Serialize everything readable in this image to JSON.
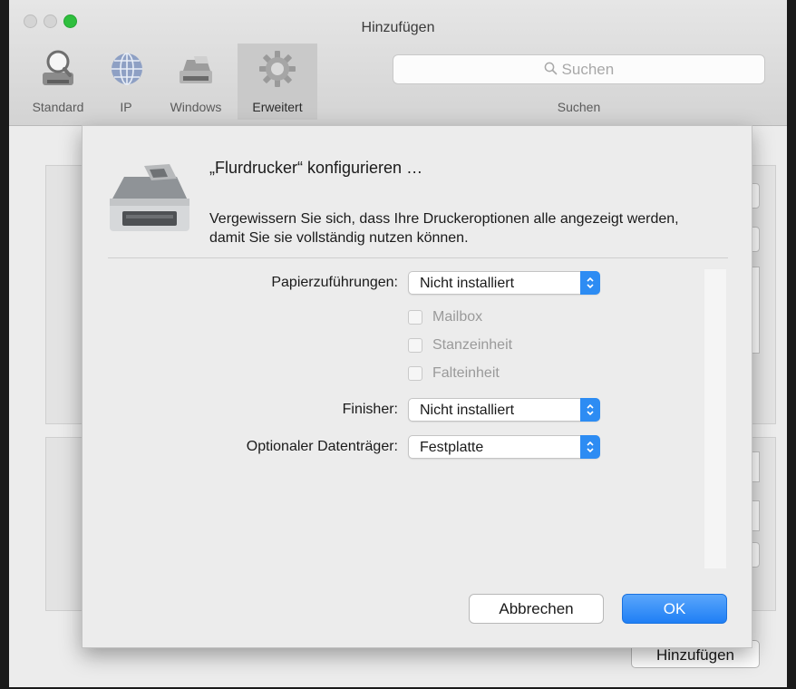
{
  "window": {
    "title": "Hinzufügen"
  },
  "toolbar": {
    "items": [
      {
        "label": "Standard",
        "icon": "magnifier-printer-icon",
        "active": false
      },
      {
        "label": "IP",
        "icon": "globe-icon",
        "active": false
      },
      {
        "label": "Windows",
        "icon": "printer-icon",
        "active": false
      },
      {
        "label": "Erweitert",
        "icon": "gear-icon",
        "active": true
      }
    ],
    "search": {
      "placeholder_icon": "search-icon",
      "placeholder": "Suchen",
      "label": "Suchen"
    }
  },
  "background": {
    "add_button_label": "Hinzufügen"
  },
  "sheet": {
    "icon": "printer-icon",
    "title": "„Flurdrucker“ konfigurieren …",
    "description": "Vergewissern Sie sich, dass Ihre Druckeroptionen alle angezeigt werden, damit Sie sie vollständig nutzen können.",
    "options": {
      "paper_feed": {
        "label": "Papierzuführungen:",
        "value": "Nicht installiert"
      },
      "checkboxes": [
        {
          "label": "Mailbox",
          "checked": false,
          "enabled": false
        },
        {
          "label": "Stanzeinheit",
          "checked": false,
          "enabled": false
        },
        {
          "label": "Falteinheit",
          "checked": false,
          "enabled": false
        }
      ],
      "finisher": {
        "label": "Finisher:",
        "value": "Nicht installiert"
      },
      "storage": {
        "label": "Optionaler Datenträger:",
        "value": "Festplatte"
      }
    },
    "buttons": {
      "cancel": "Abbrechen",
      "ok": "OK"
    }
  },
  "colors": {
    "accent": "#2d8cf3",
    "close_gray": "#d4d4d4",
    "zoom_green": "#2fbf3e"
  }
}
